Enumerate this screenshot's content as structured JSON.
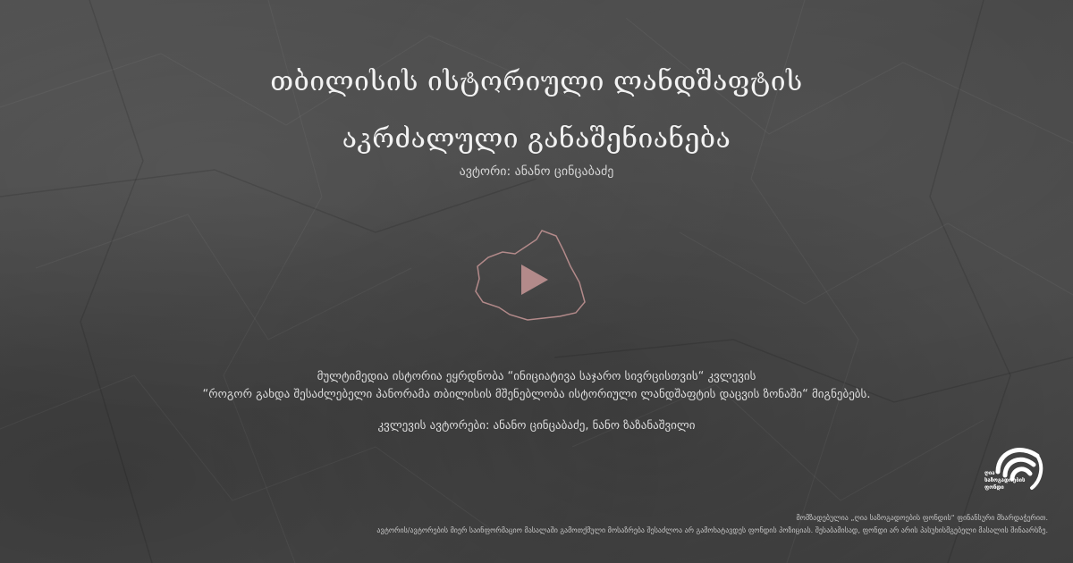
{
  "title": {
    "line1": "თბილისის ისტორიული ლანდშაფტის",
    "line2": "აკრძალული განაშენიანება"
  },
  "author": "ავტორი: ანანო ცინცაბაძე",
  "description": {
    "line1": "მულტიმედია ისტორია ეყრდნობა “ინიციატივა საჯარო სივრცისთვის“ კვლევის",
    "line2": "“როგორ გახდა შესაძლებელი პანორამა თბილისის მშენებლობა ისტორიული ლანდშაფტის დაცვის ზონაში“ მიგნებებს."
  },
  "research_authors": "კვლევის ავტორები: ანანო ცინცაბაძე, ნანო ზაზანაშვილი",
  "logo": {
    "icon": "logo-waves-icon",
    "lines": [
      "ღია",
      "საზოგადოების",
      "ფონდი"
    ]
  },
  "footer": {
    "line1": "მომზადებულია „ღია საზოგადოების ფონდის“ ფინანსური მხარდაჭერით.",
    "line2": "ავტორის/ავტორების მიერ საინფორმაციო მასალაში გამოთქმული მოსაზრება შესაძლოა არ გამოხატავდეს ფონდის პოზიციას. შესაბამისად, ფონდი არ არის პასუხისმგებელი მასალის შინაარსზე."
  },
  "colors": {
    "background": "#4a4a4a",
    "accent": "#b38a8a"
  },
  "video": {
    "icon": "play-icon"
  }
}
